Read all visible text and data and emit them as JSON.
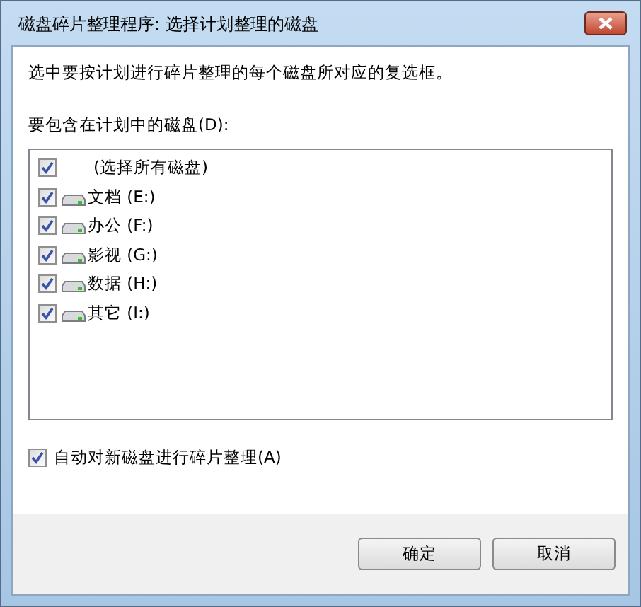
{
  "window": {
    "title": "磁盘碎片整理程序: 选择计划整理的磁盘"
  },
  "instruction": "选中要按计划进行碎片整理的每个磁盘所对应的复选框。",
  "disk_list": {
    "label": "要包含在计划中的磁盘(D):",
    "items": [
      {
        "kind": "all",
        "label": "(选择所有磁盘)",
        "checked": true
      },
      {
        "kind": "drive",
        "label": "文档 (E:)",
        "checked": true
      },
      {
        "kind": "drive",
        "label": "办公 (F:)",
        "checked": true
      },
      {
        "kind": "drive",
        "label": "影视 (G:)",
        "checked": true
      },
      {
        "kind": "drive",
        "label": "数据 (H:)",
        "checked": true
      },
      {
        "kind": "drive",
        "label": "其它 (I:)",
        "checked": true
      }
    ]
  },
  "auto_defrag": {
    "label": "自动对新磁盘进行碎片整理(A)",
    "checked": true
  },
  "buttons": [
    "确定",
    "取消"
  ]
}
